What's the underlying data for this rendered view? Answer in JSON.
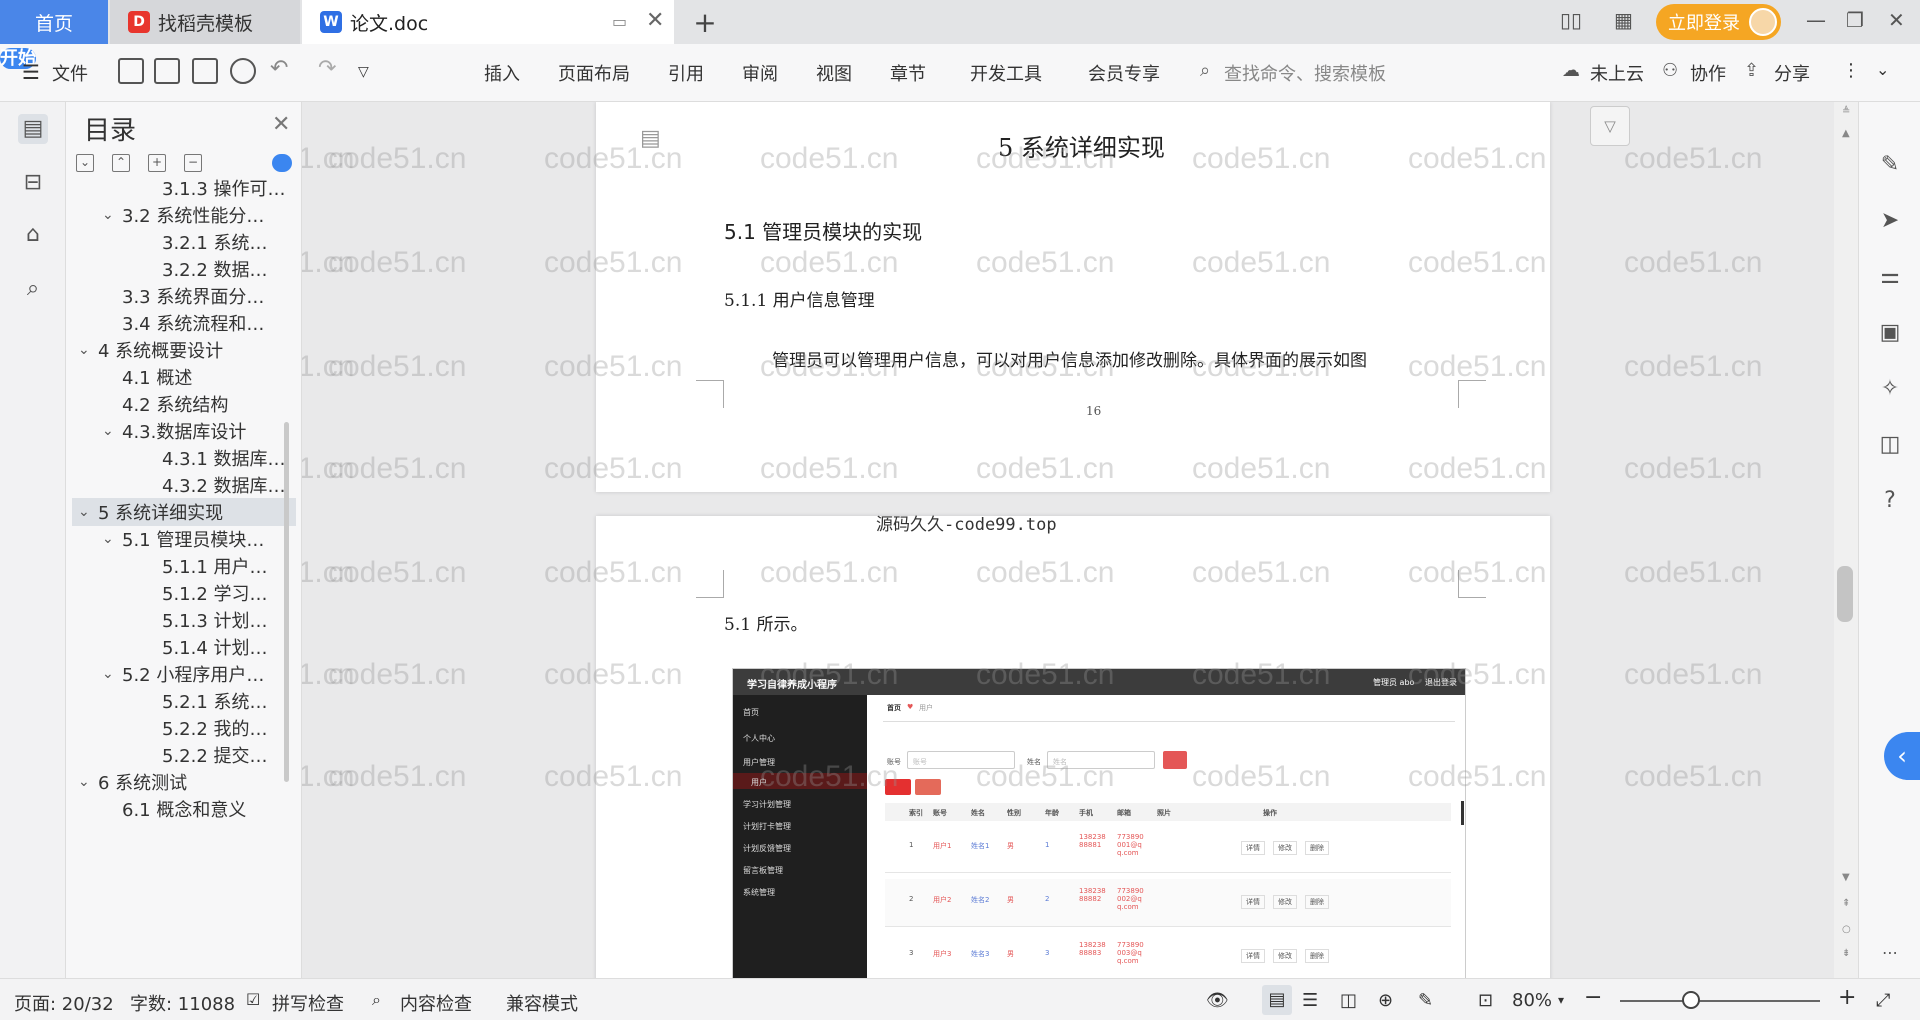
{
  "tabs": {
    "home": "首页",
    "templates": "找稻壳模板",
    "document": "论文.doc",
    "add": "+"
  },
  "header": {
    "login": "立即登录"
  },
  "ribbon": {
    "file": "文件",
    "menus": [
      "开始",
      "插入",
      "页面布局",
      "引用",
      "审阅",
      "视图",
      "章节",
      "开发工具",
      "会员专享"
    ],
    "search_placeholder": "查找命令、搜索模板",
    "cloud": "未上云",
    "collab": "协作",
    "share": "分享"
  },
  "toc": {
    "title": "目录",
    "items": [
      {
        "label": "3.1.3 操作可…",
        "level": 3,
        "arrow": ""
      },
      {
        "label": "3.2 系统性能分…",
        "level": 2,
        "arrow": "v"
      },
      {
        "label": "3.2.1 系统…",
        "level": 3,
        "arrow": ""
      },
      {
        "label": "3.2.2 数据…",
        "level": 3,
        "arrow": ""
      },
      {
        "label": "3.3 系统界面分…",
        "level": 2,
        "arrow": ""
      },
      {
        "label": "3.4 系统流程和…",
        "level": 2,
        "arrow": ""
      },
      {
        "label": "4 系统概要设计",
        "level": 1,
        "arrow": "v"
      },
      {
        "label": "4.1 概述",
        "level": 2,
        "arrow": ""
      },
      {
        "label": "4.2 系统结构",
        "level": 2,
        "arrow": ""
      },
      {
        "label": "4.3.数据库设计",
        "level": 2,
        "arrow": "v"
      },
      {
        "label": "4.3.1 数据库…",
        "level": 3,
        "arrow": ""
      },
      {
        "label": "4.3.2 数据库…",
        "level": 3,
        "arrow": ""
      },
      {
        "label": "5 系统详细实现",
        "level": 1,
        "arrow": "v",
        "selected": true
      },
      {
        "label": "5.1 管理员模块…",
        "level": 2,
        "arrow": "v"
      },
      {
        "label": "5.1.1 用户…",
        "level": 3,
        "arrow": ""
      },
      {
        "label": "5.1.2 学习…",
        "level": 3,
        "arrow": ""
      },
      {
        "label": "5.1.3 计划…",
        "level": 3,
        "arrow": ""
      },
      {
        "label": "5.1.4 计划…",
        "level": 3,
        "arrow": ""
      },
      {
        "label": "5.2 小程序用户…",
        "level": 2,
        "arrow": "v"
      },
      {
        "label": "5.2.1 系统…",
        "level": 3,
        "arrow": ""
      },
      {
        "label": "5.2.2 我的…",
        "level": 3,
        "arrow": ""
      },
      {
        "label": "5.2.2 提交…",
        "level": 3,
        "arrow": ""
      },
      {
        "label": "6 系统测试",
        "level": 1,
        "arrow": "v"
      },
      {
        "label": "6.1 概念和意义",
        "level": 2,
        "arrow": ""
      }
    ]
  },
  "document": {
    "chapter_title": "5 系统详细实现",
    "section_title": "5.1  管理员模块的实现",
    "subsection_title": "5.1.1  用户信息管理",
    "paragraph": "管理员可以管理用户信息，可以对用户信息添加修改删除。具体界面的展示如图",
    "page_number": "16",
    "header_note": "源码久久-code99.top",
    "continued": "5.1 所示。",
    "watermark": "code51.cn"
  },
  "embedded_app": {
    "title": "学习自律养成小程序",
    "user": "管理员 abo",
    "logout": "退出登录",
    "menu": [
      "首页",
      "个人中心",
      "用户管理",
      "用户",
      "学习计划管理",
      "计划打卡管理",
      "计划反馈管理",
      "留言板管理",
      "系统管理"
    ],
    "breadcrumb": "首页",
    "breadcrumb_sub": "用户",
    "search_labels": [
      "账号",
      "姓名"
    ],
    "search_placeholders": [
      "账号",
      "姓名"
    ],
    "columns": [
      "索引",
      "账号",
      "姓名",
      "性别",
      "年龄",
      "手机",
      "邮箱",
      "照片",
      "操作"
    ],
    "rows": [
      {
        "idx": "1",
        "account": "用户1",
        "name": "姓名1",
        "sex": "男",
        "age": "1",
        "phone": "13823888881",
        "email": "773890001@qq.com"
      },
      {
        "idx": "2",
        "account": "用户2",
        "name": "姓名2",
        "sex": "男",
        "age": "2",
        "phone": "13823888882",
        "email": "773890002@qq.com"
      },
      {
        "idx": "3",
        "account": "用户3",
        "name": "姓名3",
        "sex": "男",
        "age": "3",
        "phone": "13823888883",
        "email": "773890003@qq.com"
      }
    ],
    "actions": [
      "详情",
      "修改",
      "删除"
    ]
  },
  "status": {
    "page": "页面: 20/32",
    "words": "字数: 11088",
    "spell": "拼写检查",
    "content": "内容检查",
    "compat": "兼容模式",
    "zoom": "80%"
  }
}
